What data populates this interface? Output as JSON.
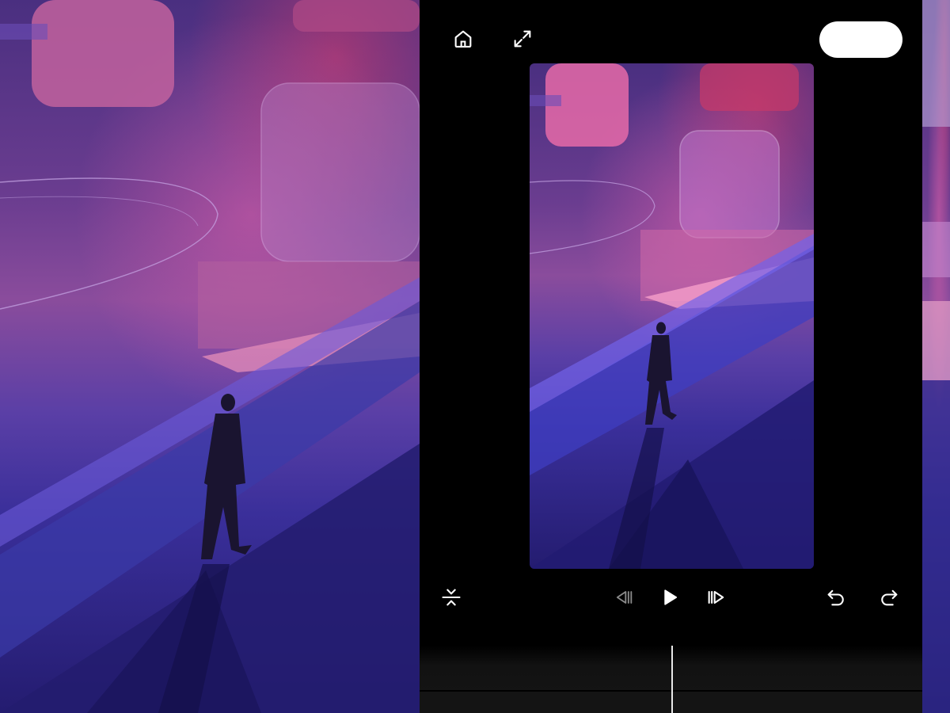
{
  "toolbar": {
    "home_icon": "home-icon",
    "fullscreen_icon": "expand-icon",
    "action_pill_label": ""
  },
  "playback": {
    "split_icon": "split-vertical-icon",
    "prev_frame_icon": "skip-back-icon",
    "play_icon": "play-icon",
    "next_frame_icon": "skip-forward-icon",
    "undo_icon": "undo-icon",
    "redo_icon": "redo-icon"
  },
  "timeline": {
    "playhead_position": 0.5
  },
  "colors": {
    "panel_background": "#000000",
    "icon_color": "#ffffff",
    "disabled_icon_color": "#8a8a8a",
    "pill_background": "#ffffff",
    "timeline_background": "#141414"
  }
}
